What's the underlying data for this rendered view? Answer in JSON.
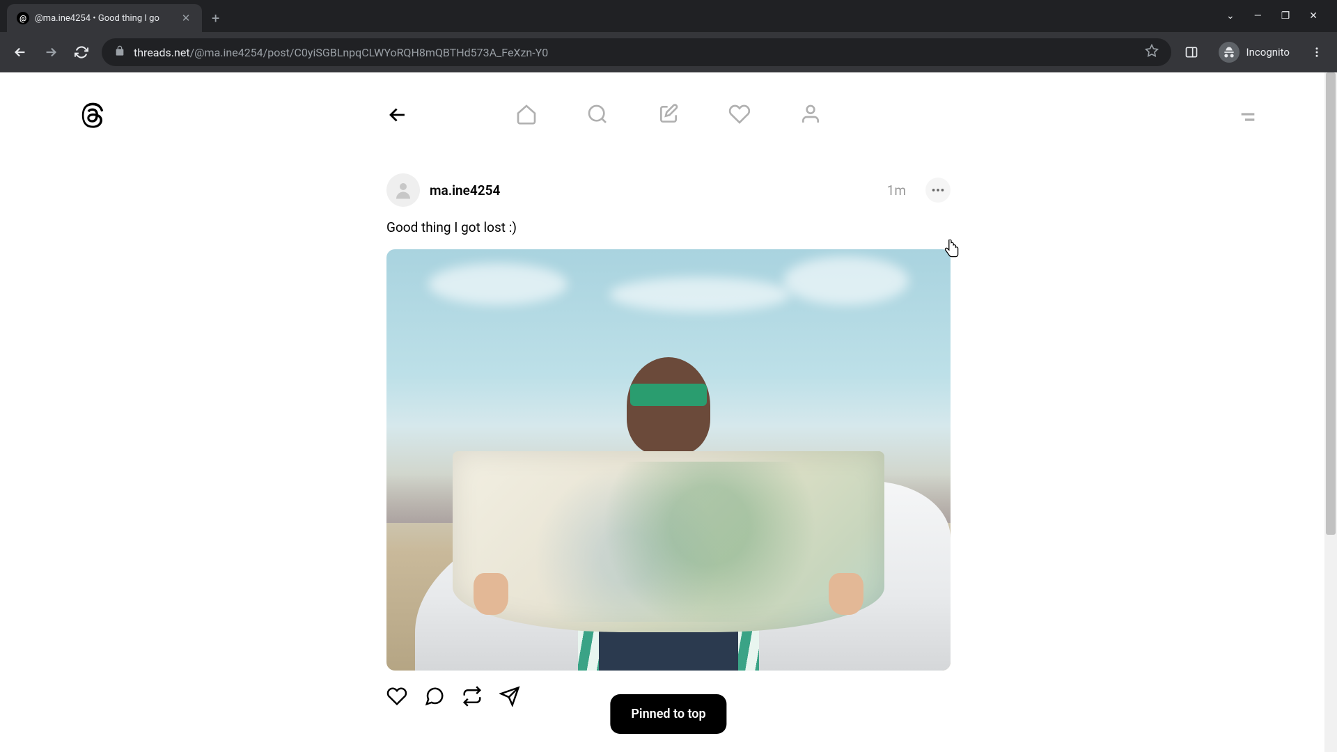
{
  "browser": {
    "tab_title": "@ma.ine4254 • Good thing I go",
    "url_host": "threads.net",
    "url_path": "/@ma.ine4254/post/C0yiSGBLnpqCLWYoRQH8mQBTHd573A_FeXzn-Y0",
    "incognito_label": "Incognito"
  },
  "nav": {
    "back_icon": "arrow-left",
    "items": [
      "home",
      "search",
      "create",
      "activity",
      "profile"
    ]
  },
  "post": {
    "username": "ma.ine4254",
    "timestamp": "1m",
    "text": "Good thing I got lost :)"
  },
  "toast": {
    "message": "Pinned to top"
  }
}
